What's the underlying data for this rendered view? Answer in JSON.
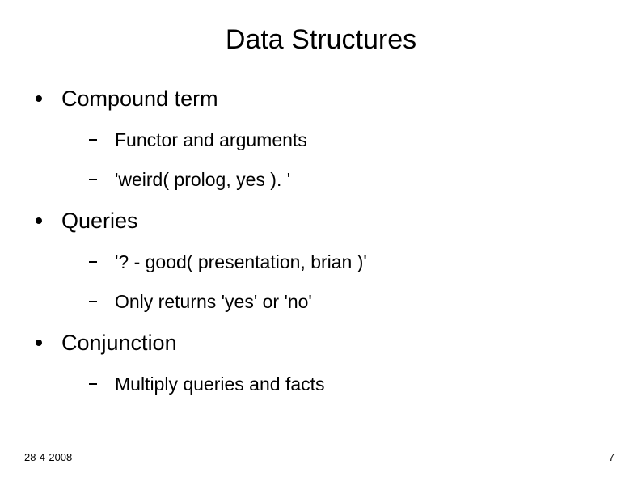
{
  "slide": {
    "title": "Data Structures",
    "items": [
      {
        "label": "Compound term",
        "sub": [
          "Functor and arguments",
          "'weird( prolog, yes ). '"
        ]
      },
      {
        "label": "Queries",
        "sub": [
          "'? - good( presentation, brian )'",
          "Only returns 'yes' or 'no'"
        ]
      },
      {
        "label": "Conjunction",
        "sub": [
          "Multiply queries and facts"
        ]
      }
    ],
    "footer": {
      "date": "28-4-2008",
      "page": "7"
    }
  }
}
